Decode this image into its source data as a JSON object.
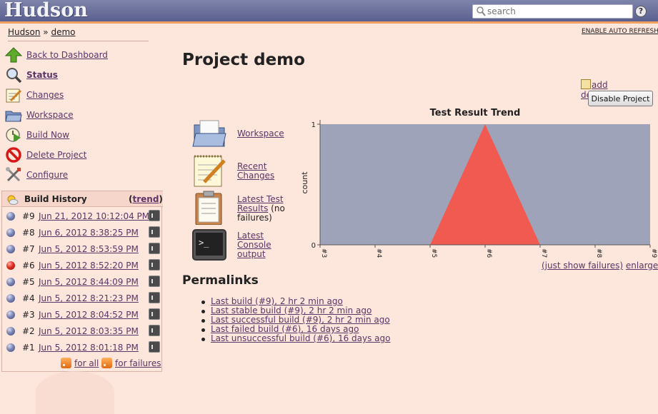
{
  "header": {
    "logo": "Hudson",
    "search_placeholder": "search",
    "help": "?"
  },
  "breadcrumb": {
    "items": [
      "Hudson",
      "demo"
    ],
    "separator": "»",
    "auto_refresh": "ENABLE AUTO REFRESH"
  },
  "sidebar": {
    "tasks": [
      {
        "label": "Back to Dashboard",
        "icon": "up-arrow-icon"
      },
      {
        "label": "Status",
        "icon": "magnifier-icon"
      },
      {
        "label": "Changes",
        "icon": "notepad-icon"
      },
      {
        "label": "Workspace",
        "icon": "folder-icon"
      },
      {
        "label": "Build Now",
        "icon": "clock-build-icon"
      },
      {
        "label": "Delete Project",
        "icon": "no-entry-icon"
      },
      {
        "label": "Configure",
        "icon": "tools-icon"
      }
    ]
  },
  "build_history": {
    "title": "Build History",
    "trend_open": "(",
    "trend": "trend",
    "trend_close": ")",
    "builds": [
      {
        "num": "#9",
        "date": "Jun 21, 2012 10:12:04 PM",
        "status": "blue"
      },
      {
        "num": "#8",
        "date": "Jun 6, 2012 8:38:25 PM",
        "status": "blue"
      },
      {
        "num": "#7",
        "date": "Jun 5, 2012 8:53:59 PM",
        "status": "blue"
      },
      {
        "num": "#6",
        "date": "Jun 5, 2012 8:52:20 PM",
        "status": "red"
      },
      {
        "num": "#5",
        "date": "Jun 5, 2012 8:44:09 PM",
        "status": "blue"
      },
      {
        "num": "#4",
        "date": "Jun 5, 2012 8:21:23 PM",
        "status": "blue"
      },
      {
        "num": "#3",
        "date": "Jun 5, 2012 8:04:52 PM",
        "status": "blue"
      },
      {
        "num": "#2",
        "date": "Jun 5, 2012 8:03:35 PM",
        "status": "blue"
      },
      {
        "num": "#1",
        "date": "Jun 5, 2012 8:01:18 PM",
        "status": "blue"
      }
    ],
    "rss_all": "for all",
    "rss_failures": "for failures"
  },
  "main": {
    "title": "Project demo",
    "add_description": "add description",
    "disable_button": "Disable Project",
    "links": {
      "workspace": "Workspace",
      "recent_changes": "Recent Changes",
      "latest_test_results": "Latest Test Results",
      "no_failures": "(no failures)",
      "latest_console": "Latest Console output"
    },
    "just_show_failures": "(just show failures)",
    "enlarge": "enlarge",
    "permalinks_title": "Permalinks",
    "permalinks": [
      "Last build (#9), 2 hr 2 min ago",
      "Last stable build (#9), 2 hr 2 min ago",
      "Last successful build (#9), 2 hr 2 min ago",
      "Last failed build (#6), 16 days ago",
      "Last unsuccessful build (#6), 16 days ago"
    ]
  },
  "colors": {
    "page_bg": "#fde6dc",
    "header_bg": "#5a608f",
    "link": "#5c3566",
    "chart_pass": "#9fa3b9",
    "chart_fail": "#f05a50"
  },
  "chart_data": {
    "type": "area",
    "title": "Test Result Trend",
    "ylabel": "count",
    "xlabel": "",
    "categories": [
      "#3",
      "#4",
      "#5",
      "#6",
      "#7",
      "#8",
      "#9"
    ],
    "ylim": [
      0,
      1
    ],
    "yticks": [
      0,
      1
    ],
    "series": [
      {
        "name": "",
        "color": "#f05a50",
        "values": [
          0,
          0,
          0,
          1,
          0,
          0,
          0
        ]
      },
      {
        "name": "",
        "color": "#9fa3b9",
        "values": [
          1,
          1,
          1,
          1,
          1,
          1,
          1
        ]
      }
    ]
  }
}
